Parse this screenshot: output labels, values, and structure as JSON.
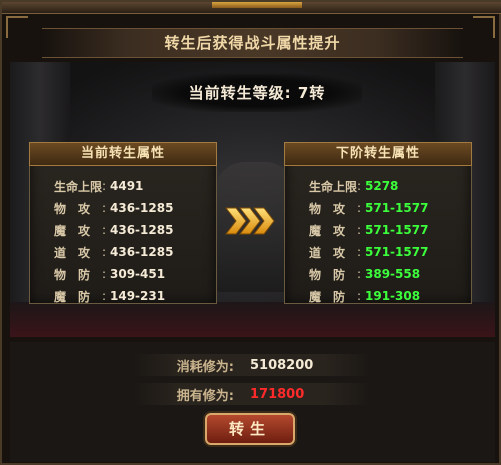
{
  "title": "转生后获得战斗属性提升",
  "level": {
    "label": "当前转生等级:",
    "value": "7转"
  },
  "current": {
    "header": "当前转生属性",
    "rows": [
      {
        "label": "生命上限",
        "value": "4491"
      },
      {
        "label": "物　攻",
        "value": "436-1285"
      },
      {
        "label": "魔　攻",
        "value": "436-1285"
      },
      {
        "label": "道　攻",
        "value": "436-1285"
      },
      {
        "label": "物　防",
        "value": "309-451"
      },
      {
        "label": "魔　防",
        "value": "149-231"
      }
    ]
  },
  "next": {
    "header": "下阶转生属性",
    "rows": [
      {
        "label": "生命上限",
        "value": "5278"
      },
      {
        "label": "物　攻",
        "value": "571-1577"
      },
      {
        "label": "魔　攻",
        "value": "571-1577"
      },
      {
        "label": "道　攻",
        "value": "571-1577"
      },
      {
        "label": "物　防",
        "value": "389-558"
      },
      {
        "label": "魔　防",
        "value": "191-308"
      }
    ]
  },
  "cost": {
    "label": "消耗修为:",
    "value": "5108200"
  },
  "owned": {
    "label": "拥有修为:",
    "value": "171800"
  },
  "button": {
    "label": "转生"
  },
  "colors": {
    "owned_value": "#ff2a2a",
    "next_values": "#3cff3c",
    "arrows": "#f5b21a"
  },
  "icons": {
    "arrow": "triple-chevron-right-icon"
  }
}
